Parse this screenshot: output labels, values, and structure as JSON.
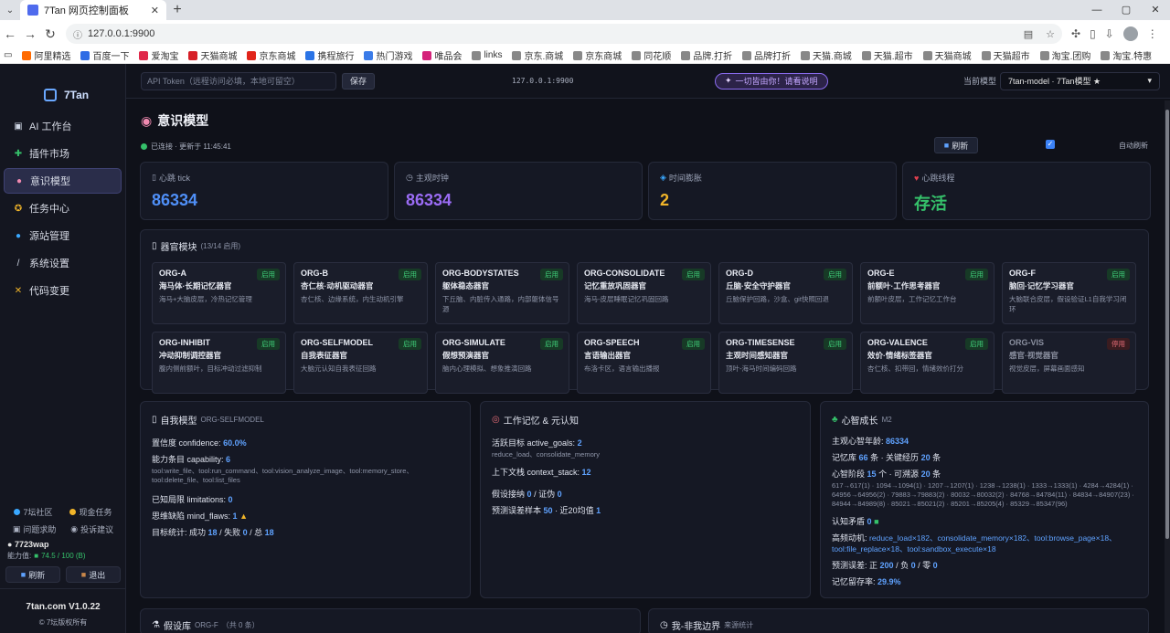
{
  "browser": {
    "tab_title": "7Tan 网页控制面板",
    "url": "127.0.0.1:9900",
    "bookmarks": [
      "阿里精选",
      "百度一下",
      "爱淘宝",
      "天猫商城",
      "京东商城",
      "携程旅行",
      "热门游戏",
      "唯品会",
      "links",
      "京东.商城",
      "京东商城",
      "同花顺",
      "品牌.打折",
      "品牌打折",
      "天猫.商城",
      "天猫.超市",
      "天猫商城",
      "天猫超市",
      "淘宝.团购",
      "淘宝.特惠"
    ]
  },
  "sidebar": {
    "brand": "7Tan",
    "items": [
      {
        "icon": "▣",
        "label": "AI 工作台"
      },
      {
        "icon": "✚",
        "label": "插件市场"
      },
      {
        "icon": "●",
        "label": "意识模型"
      },
      {
        "icon": "✪",
        "label": "任务中心"
      },
      {
        "icon": "●",
        "label": "源站管理"
      },
      {
        "icon": "/",
        "label": "系统设置"
      },
      {
        "icon": "✕",
        "label": "代码变更"
      }
    ],
    "links": [
      "7坛社区",
      "现金任务",
      "问题求助",
      "投诉建议"
    ],
    "username": "7723wap",
    "capability_label": "能力值:",
    "capability_value": "74.5 / 100 (B)",
    "refresh_label": "刷新",
    "logout_label": "退出",
    "version": "7tan.com V1.0.22",
    "copyright": "© 7坛版权所有"
  },
  "topbar": {
    "token_placeholder": "API Token（远程访问必填，本地可留空）",
    "save_label": "保存",
    "host": "127.0.0.1:9900",
    "pill_text": "一切皆由你！请看说明",
    "model_label": "当前模型",
    "model_value": "7tan-model · 7Tan模型 ★"
  },
  "page": {
    "title": "意识模型",
    "status": "已连接 · 更新于 11:45:41",
    "refresh_label": "刷新",
    "auto_refresh": "自动刷新"
  },
  "stats": [
    {
      "label": "心跳 tick",
      "value": "86334",
      "color": "#4f8ff7"
    },
    {
      "label": "主观时钟",
      "value": "86334",
      "color": "#9b6cf5"
    },
    {
      "label": "时间膨胀",
      "value": "2",
      "color": "#f0b429"
    },
    {
      "label": "心跳线程",
      "value": "存活",
      "color": "#35c06a"
    }
  ],
  "organs": {
    "title": "器官模块",
    "count": "(13/14 启用)",
    "items": [
      {
        "code": "ORG-A",
        "name": "海马体·长期记忆器官",
        "desc": "海马+大脑皮层，冷热记忆管理",
        "status": "启用"
      },
      {
        "code": "ORG-B",
        "name": "杏仁核·动机驱动器官",
        "desc": "杏仁核、边缘系统，内生动机引擎",
        "status": "启用"
      },
      {
        "code": "ORG-BODYSTATES",
        "name": "躯体稳态器官",
        "desc": "下丘脑、内脏传入通路，内部躯体信号源",
        "status": "启用"
      },
      {
        "code": "ORG-CONSOLIDATE",
        "name": "记忆重放巩固器官",
        "desc": "海马-皮层睡眠记忆巩固回路",
        "status": "启用"
      },
      {
        "code": "ORG-D",
        "name": "丘脑·安全守护器官",
        "desc": "丘脑保护回路，沙盒、git快照回退",
        "status": "启用"
      },
      {
        "code": "ORG-E",
        "name": "前额叶·工作思考器官",
        "desc": "前额叶皮层，工作记忆工作台",
        "status": "启用"
      },
      {
        "code": "ORG-F",
        "name": "脑回·记忆学习器官",
        "desc": "大脑联合皮层，假设验证L1自我学习闭环",
        "status": "启用"
      },
      {
        "code": "ORG-INHIBIT",
        "name": "冲动抑制调控器官",
        "desc": "腹内侧前额叶，目标冲动过滤抑制",
        "status": "启用"
      },
      {
        "code": "ORG-SELFMODEL",
        "name": "自我表征器官",
        "desc": "大脑元认知自我表征回路",
        "status": "启用"
      },
      {
        "code": "ORG-SIMULATE",
        "name": "假想预演器官",
        "desc": "脑内心理模拟、想象推演回路",
        "status": "启用"
      },
      {
        "code": "ORG-SPEECH",
        "name": "言语输出器官",
        "desc": "布洛卡区，语言输出播报",
        "status": "启用"
      },
      {
        "code": "ORG-TIMESENSE",
        "name": "主观时间感知器官",
        "desc": "顶叶-海马时间编码回路",
        "status": "启用"
      },
      {
        "code": "ORG-VALENCE",
        "name": "效价·情绪标签器官",
        "desc": "杏仁核、扣带回，情绪效价打分",
        "status": "启用"
      },
      {
        "code": "ORG-VIS",
        "name": "感官·视觉器官",
        "desc": "视觉皮层，屏幕画面感知",
        "status": "停用"
      }
    ]
  },
  "selfmodel": {
    "title": "自我模型",
    "tag": "ORG-SELFMODEL",
    "confidence_label": "置信度 confidence:",
    "confidence": "60.0%",
    "capability_label": "能力条目 capability:",
    "capability": "6",
    "tools": "tool:write_file、tool:run_command、tool:vision_analyze_image、tool:memory_store、tool:delete_file、tool:list_files",
    "limitations_label": "已知局限 limitations:",
    "limitations": "0",
    "flaws_label": "思维缺陷 mind_flaws:",
    "flaws": "1",
    "goals_label": "目标统计: 成功",
    "goals_success": "18",
    "goals_fail_label": "/ 失败",
    "goals_fail": "0",
    "goals_total_label": "/ 总",
    "goals_total": "18"
  },
  "workmem": {
    "title": "工作记忆 & 元认知",
    "active_label": "活跃目标 active_goals:",
    "active": "2",
    "active_list": "reduce_load、consolidate_memory",
    "ctx_label": "上下文栈 context_stack:",
    "ctx": "12",
    "hyp_label": "假设接纳",
    "hyp_accept": "0",
    "hyp_sep": "/ 证伪",
    "hyp_reject": "0",
    "pred_label": "预测误差样本",
    "pred_samples": "50",
    "pred_sep": "· 近20均值",
    "pred_avg": "1"
  },
  "growth": {
    "title": "心智成长",
    "tag": "M2",
    "age_label": "主观心智年龄:",
    "age": "86334",
    "mem_label": "记忆库",
    "mem_count": "66",
    "mem_mid": "条 · 关键经历",
    "key_exp": "20",
    "mem_unit": "条",
    "stage_label": "心智阶段",
    "stage": "15",
    "stage_mid": "个 · 可溯源",
    "trace": "20",
    "stage_unit": "条",
    "history": "617→617(1) · 1094→1094(1) · 1207→1207(1) · 1238→1238(1) · 1333→1333(1) · 4284→4284(1) · 64956→64956(2) · 79883→79883(2) · 80032→80032(2) · 84768→84784(11) · 84834→84907(23) · 84944→84989(8) · 85021→85021(2) · 85201→85205(4) · 85329→85347(96)",
    "conflict_label": "认知矛盾",
    "conflict": "0",
    "motive_label": "高频动机:",
    "motives": "reduce_load×182、consolidate_memory×182、tool:browse_page×18、tool:file_replace×18、tool:sandbox_execute×18",
    "pe_label": "预测误差: 正",
    "pe_pos": "200",
    "pe_neg_label": "/ 负",
    "pe_neg": "0",
    "pe_zero_label": "/ 零",
    "pe_zero": "0",
    "retention_label": "记忆留存率:",
    "retention": "29.9%"
  },
  "bottom": {
    "hyp_title": "假设库",
    "hyp_tag": "ORG-F",
    "hyp_count": "（共 0 条）",
    "border_title": "我-非我边界",
    "border_tag": "来源统计"
  }
}
